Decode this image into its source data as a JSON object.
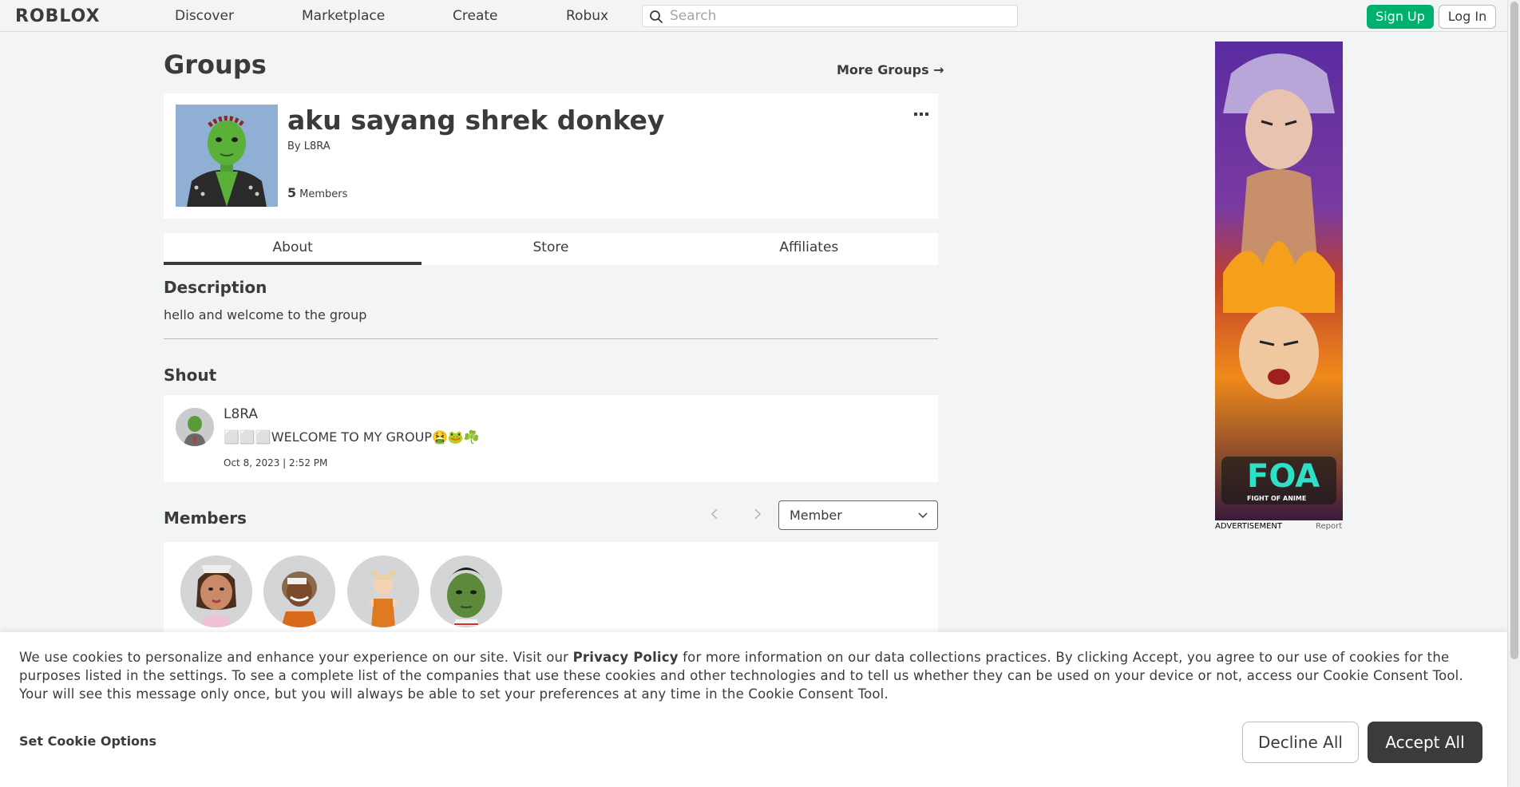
{
  "nav": {
    "logo": "ROBLOX",
    "links": [
      "Discover",
      "Marketplace",
      "Create",
      "Robux"
    ],
    "search_placeholder": "Search",
    "signup_label": "Sign Up",
    "login_label": "Log In"
  },
  "page": {
    "title": "Groups",
    "more_groups": "More Groups →"
  },
  "group": {
    "name": "aku sayang shrek donkey",
    "by_prefix": "By",
    "owner": "L8RA",
    "member_count": "5",
    "member_label": "Members"
  },
  "tabs": [
    "About",
    "Store",
    "Affiliates"
  ],
  "about": {
    "description_heading": "Description",
    "description": "hello and welcome to the group"
  },
  "shout": {
    "heading": "Shout",
    "poster": "L8RA",
    "text": "⬜⬜⬜WELCOME TO MY GROUP🤮🐸☘️",
    "date": "Oct 8, 2023 | 2:52 PM"
  },
  "members": {
    "heading": "Members",
    "role_selected": "Member"
  },
  "ad": {
    "label": "ADVERTISEMENT",
    "report": "Report",
    "logo_text": "FOA",
    "logo_sub": "FIGHT OF ANIME"
  },
  "cookie": {
    "text_before": "We use cookies to personalize and enhance your experience on our site. Visit our ",
    "privacy_link": "Privacy Policy",
    "text_after": " for more information on our data collections practices. By clicking Accept, you agree to our use of cookies for the purposes listed in the settings. To see a complete list of the companies that use these cookies and other technologies and to tell us whether they can be used on your device or not, access our Cookie Consent Tool. Your will see this message only once, but you will always be able to set your preferences at any time in the Cookie Consent Tool.",
    "options_label": "Set Cookie Options",
    "decline_label": "Decline All",
    "accept_label": "Accept All"
  },
  "colors": {
    "brand_green": "#00b06f",
    "text": "#393b3d",
    "background": "#f2f4f5"
  }
}
